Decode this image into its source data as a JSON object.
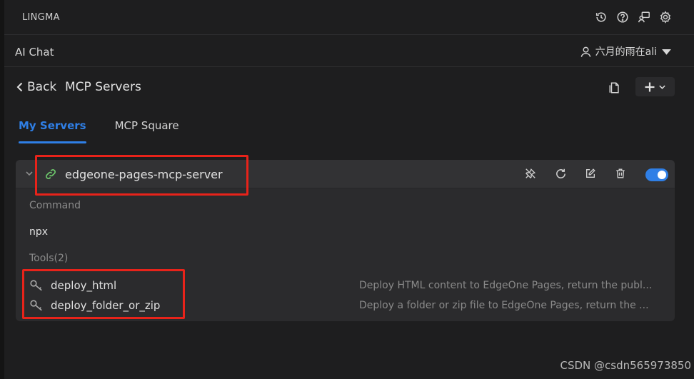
{
  "app": {
    "title": "LINGMA"
  },
  "top_icons": [
    "history-icon",
    "help-icon",
    "feedback-icon",
    "gear-icon"
  ],
  "subbar": {
    "title": "AI Chat",
    "user_name": "六月的雨在ali"
  },
  "header": {
    "back_label": "Back",
    "page_title": "MCP Servers"
  },
  "tabs": [
    {
      "label": "My Servers",
      "active": true
    },
    {
      "label": "MCP Square",
      "active": false
    }
  ],
  "server": {
    "name": "edgeone-pages-mcp-server",
    "enabled": true,
    "command_label": "Command",
    "command_value": "npx",
    "tools_label": "Tools(2)",
    "tools": [
      {
        "name": "deploy_html",
        "description": "Deploy HTML content to EdgeOne Pages, return the publ..."
      },
      {
        "name": "deploy_folder_or_zip",
        "description": "Deploy a folder or zip file to EdgeOne Pages, return the ..."
      }
    ]
  },
  "watermark": "CSDN @csdn565973850",
  "colors": {
    "accent": "#2f7fe6",
    "link_icon": "#6cc36a",
    "highlight": "#e8231a",
    "background": "#1e1e1f",
    "card": "#2b2b2d"
  }
}
